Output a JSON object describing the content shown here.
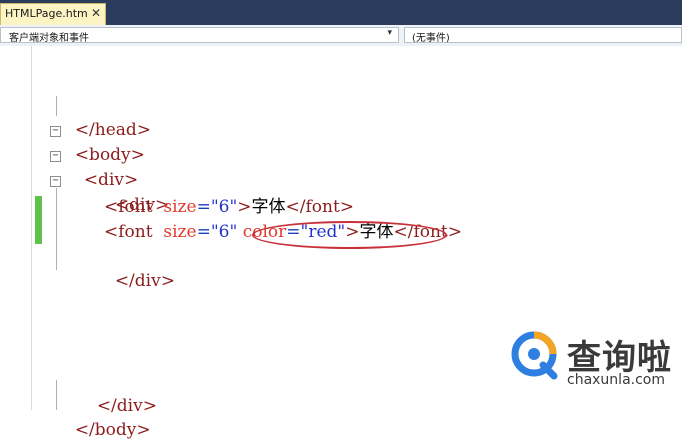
{
  "tab": {
    "title": "HTMLPage.htm",
    "close": "✕"
  },
  "navbar": {
    "left_dropdown": "客户端对象和事件",
    "right_dropdown": "(无事件)",
    "arrow": "▾"
  },
  "fold": {
    "collapse": "−"
  },
  "code": {
    "line_head_close": "</head>",
    "line_body_open": "<body>",
    "line_div1_open": "<div>",
    "line_div2_open": "<div>",
    "line_font1": {
      "open": "<font",
      "attr": "size",
      "eq": "=",
      "val": "\"6\"",
      "gt": ">",
      "text": "字体",
      "close": "</font>"
    },
    "line_font2": {
      "open": "<font",
      "attr1": "size",
      "eq1": "=",
      "val1": "\"6\"",
      "attr2": "color",
      "eq2": "=",
      "val2": "\"red\"",
      "gt": ">",
      "text": "字体",
      "close": "</font>"
    },
    "line_div2_close": "</div>",
    "line_div1_close": "</div>",
    "line_body_close": "</body>"
  },
  "watermark": {
    "cn": "查询啦",
    "en": "chaxunla.com"
  },
  "colors": {
    "tag": "#8b1c1c",
    "attr": "#e33a2f",
    "value": "#2233cc",
    "highlight": "#c8303a",
    "change_bar": "#5ec24c"
  }
}
